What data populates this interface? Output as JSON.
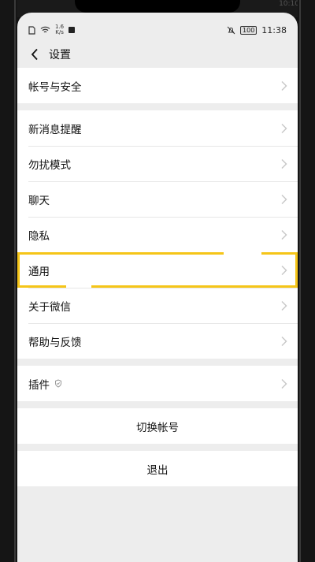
{
  "status_bar": {
    "net_speed_top": "1.6",
    "net_speed_bottom": "K/s",
    "battery": "100",
    "time": "11:38"
  },
  "top_ghost_time": "10:10",
  "nav": {
    "title": "设置"
  },
  "groups": [
    {
      "items": [
        {
          "label": "帐号与安全"
        }
      ]
    },
    {
      "items": [
        {
          "label": "新消息提醒"
        },
        {
          "label": "勿扰模式"
        },
        {
          "label": "聊天"
        },
        {
          "label": "隐私"
        },
        {
          "label": "通用",
          "highlighted": true
        },
        {
          "label": "关于微信"
        },
        {
          "label": "帮助与反馈"
        }
      ]
    },
    {
      "items": [
        {
          "label": "插件",
          "icon": "shield-icon"
        }
      ]
    }
  ],
  "actions": {
    "switch_account": "切换帐号",
    "logout": "退出"
  },
  "colors": {
    "highlight": "#f5c518",
    "background": "#ededed"
  }
}
